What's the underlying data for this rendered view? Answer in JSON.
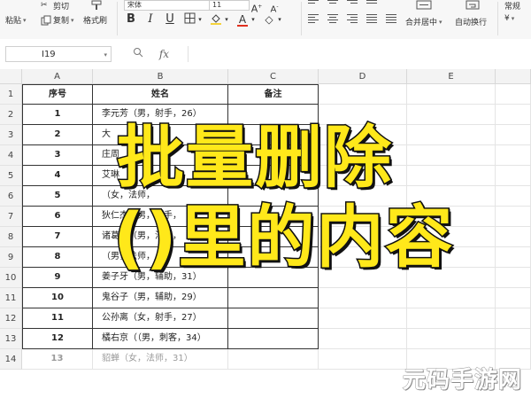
{
  "ribbon": {
    "paste_label": "粘贴",
    "cut_label": "剪切",
    "copy_label": "复制",
    "format_painter_label": "格式刷",
    "font_name": "宋体",
    "font_size": "11",
    "bold": "B",
    "italic": "I",
    "underline": "U",
    "merge_center_label": "合并居中",
    "wrap_text_label": "自动换行",
    "number_format": "常规",
    "currency_symbol": "¥"
  },
  "formula_bar": {
    "cell_ref": "I19",
    "fx_symbol": "fx",
    "value": ""
  },
  "sheet": {
    "column_headers": [
      "A",
      "B",
      "C",
      "D",
      "E"
    ],
    "row_numbers": [
      "1",
      "2",
      "3",
      "4",
      "5",
      "6",
      "7",
      "8",
      "9",
      "10",
      "11",
      "12",
      "13",
      "14"
    ],
    "header_row": {
      "seq": "序号",
      "name": "姓名",
      "note": "备注"
    },
    "rows": [
      {
        "seq": "1",
        "name": "李元芳（男，射手，26）"
      },
      {
        "seq": "2",
        "name": "大"
      },
      {
        "seq": "3",
        "name": "庄周"
      },
      {
        "seq": "4",
        "name": "艾琳"
      },
      {
        "seq": "5",
        "name": "（女，法师，"
      },
      {
        "seq": "6",
        "name": "狄仁杰（男，射手，"
      },
      {
        "seq": "7",
        "name": "诸葛亮（男，法师，"
      },
      {
        "seq": "8",
        "name": "（男，法师，"
      },
      {
        "seq": "9",
        "name": "姜子牙（男，辅助，31）"
      },
      {
        "seq": "10",
        "name": "鬼谷子（男，辅助，29）"
      },
      {
        "seq": "11",
        "name": "公孙离（女，射手，27）"
      },
      {
        "seq": "12",
        "name": "橘右京（（男，刺客，34）"
      },
      {
        "seq": "13",
        "name": "貂蝉（女，法师，31）"
      }
    ]
  },
  "overlay": {
    "line1": "批量删除",
    "line2": "()里的内容"
  },
  "watermark": "元码手游网",
  "colors": {
    "overlay_fill": "#ffe81a",
    "overlay_stroke": "#111111",
    "font_color_accent": "#e0301e"
  }
}
